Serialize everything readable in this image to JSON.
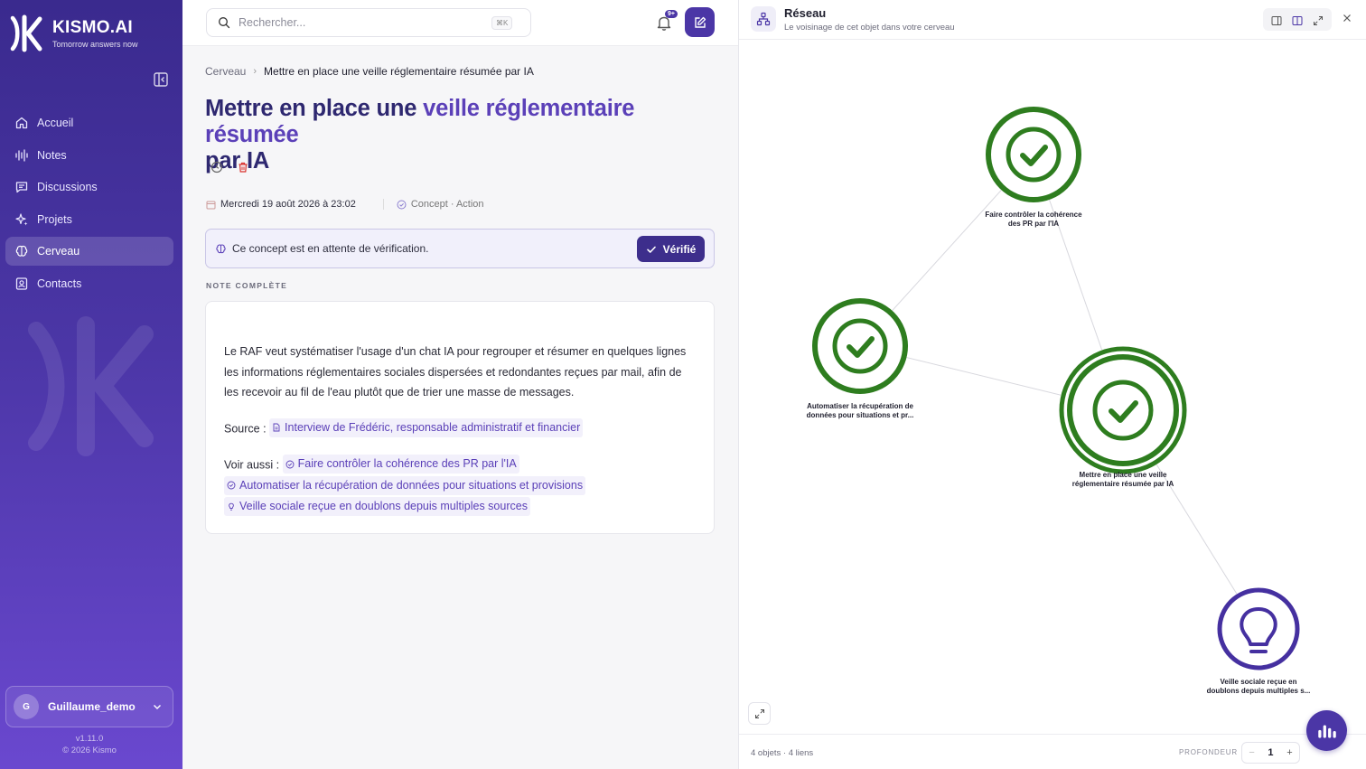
{
  "brand": {
    "name": "KISMO.AI",
    "tagline": "Tomorrow answers now"
  },
  "sidebar": {
    "items": [
      {
        "label": "Accueil",
        "icon": "home-icon"
      },
      {
        "label": "Notes",
        "icon": "waveform-icon"
      },
      {
        "label": "Discussions",
        "icon": "chat-icon"
      },
      {
        "label": "Projets",
        "icon": "sparkles-icon"
      },
      {
        "label": "Cerveau",
        "icon": "brain-icon",
        "active": true
      },
      {
        "label": "Contacts",
        "icon": "contact-card-icon"
      }
    ],
    "user": {
      "initial": "G",
      "name": "Guillaume_demo"
    },
    "version": "v1.11.0",
    "copyright": "© 2026 Kismo"
  },
  "topbar": {
    "search_placeholder": "Rechercher...",
    "search_shortcut": "⌘K",
    "notifications_badge": "9+"
  },
  "page": {
    "breadcrumb": {
      "root": "Cerveau",
      "current": "Mettre en place une veille réglementaire résumée par IA"
    },
    "title_part1": "Mettre en place une ",
    "title_part2": "veille réglementaire résumée",
    "title_part3": "par IA",
    "date": "Mercredi 19 août 2026 à 23:02",
    "concept_type": "Concept · Action",
    "pending_message": "Ce concept est en attente de vérification.",
    "verify_label": "Vérifié",
    "section_label": "NOTE COMPLÈTE",
    "note": {
      "body": "Le RAF veut systématiser l'usage d'un chat IA pour regrouper et résumer en quelques lignes les informations réglementaires sociales dispersées et redondantes reçues par mail, afin de les recevoir au fil de l'eau plutôt que de trier une masse de messages.",
      "source_label": "Source :",
      "source_link": "Interview de Frédéric, responsable administratif et financier",
      "see_also_label": "Voir aussi :",
      "see_also": [
        "Faire contrôler la cohérence des PR par l'IA",
        "Automatiser la récupération de données pour situations et provisions",
        "Veille sociale reçue en doublons depuis multiples sources"
      ]
    }
  },
  "panel": {
    "title": "Réseau",
    "subtitle": "Le voisinage de cet objet dans votre cerveau",
    "nodes": [
      {
        "label_line1": "Faire contrôler la cohérence",
        "label_line2": "des PR par l'IA"
      },
      {
        "label_line1": "Automatiser la récupération de",
        "label_line2": "données pour situations et pr..."
      },
      {
        "label_line1": "Mettre en place une veille",
        "label_line2": "réglementaire résumée par IA"
      },
      {
        "label_line1": "Veille sociale reçue en",
        "label_line2": "doublons depuis multiples s..."
      }
    ],
    "stats": "4 objets · 4 liens",
    "depth_label": "PROFONDEUR",
    "depth_value": "1",
    "depth_minus": "−",
    "depth_plus": "+"
  },
  "colors": {
    "accent": "#4b36a6",
    "node_green": "#2e7d1f",
    "node_purple": "#4530a0"
  }
}
